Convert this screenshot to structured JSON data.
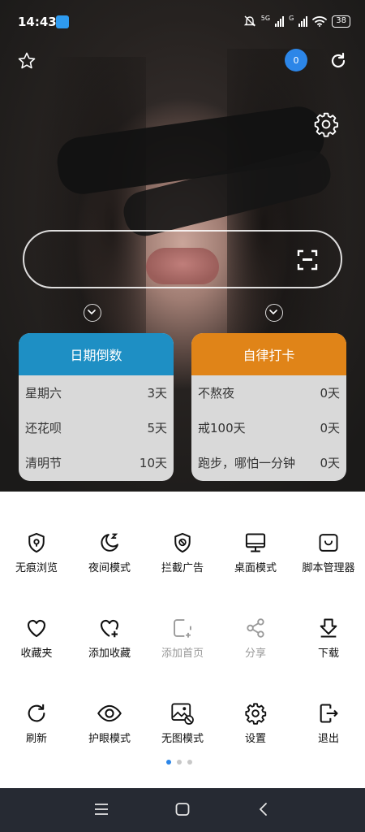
{
  "status_bar": {
    "time": "14:43",
    "signal1": "5G",
    "signal2": "G",
    "battery": "38"
  },
  "top": {
    "badge_count": "0"
  },
  "cards": {
    "left": {
      "title": "日期倒数",
      "color": "#1e8fc4",
      "rows": [
        {
          "label": "星期六",
          "value": "3天"
        },
        {
          "label": "还花呗",
          "value": "5天"
        },
        {
          "label": "清明节",
          "value": "10天"
        }
      ]
    },
    "right": {
      "title": "自律打卡",
      "color": "#e08418",
      "rows": [
        {
          "label": "不熬夜",
          "value": "0天"
        },
        {
          "label": "戒100天",
          "value": "0天"
        },
        {
          "label": "跑步，哪怕一分钟",
          "value": "0天"
        }
      ]
    }
  },
  "menu": {
    "items": [
      {
        "label": "无痕浏览",
        "icon": "shield-eye-icon"
      },
      {
        "label": "夜间模式",
        "icon": "moon-icon"
      },
      {
        "label": "拦截广告",
        "icon": "shield-block-icon"
      },
      {
        "label": "桌面模式",
        "icon": "monitor-icon"
      },
      {
        "label": "脚本管理器",
        "icon": "script-icon"
      },
      {
        "label": "收藏夹",
        "icon": "heart-icon"
      },
      {
        "label": "添加收藏",
        "icon": "heart-plus-icon"
      },
      {
        "label": "添加首页",
        "icon": "add-home-icon"
      },
      {
        "label": "分享",
        "icon": "share-icon"
      },
      {
        "label": "下载",
        "icon": "download-icon"
      },
      {
        "label": "刷新",
        "icon": "refresh-icon"
      },
      {
        "label": "护眼模式",
        "icon": "eye-icon"
      },
      {
        "label": "无图模式",
        "icon": "no-image-icon"
      },
      {
        "label": "设置",
        "icon": "gear-icon"
      },
      {
        "label": "退出",
        "icon": "exit-icon"
      }
    ]
  }
}
